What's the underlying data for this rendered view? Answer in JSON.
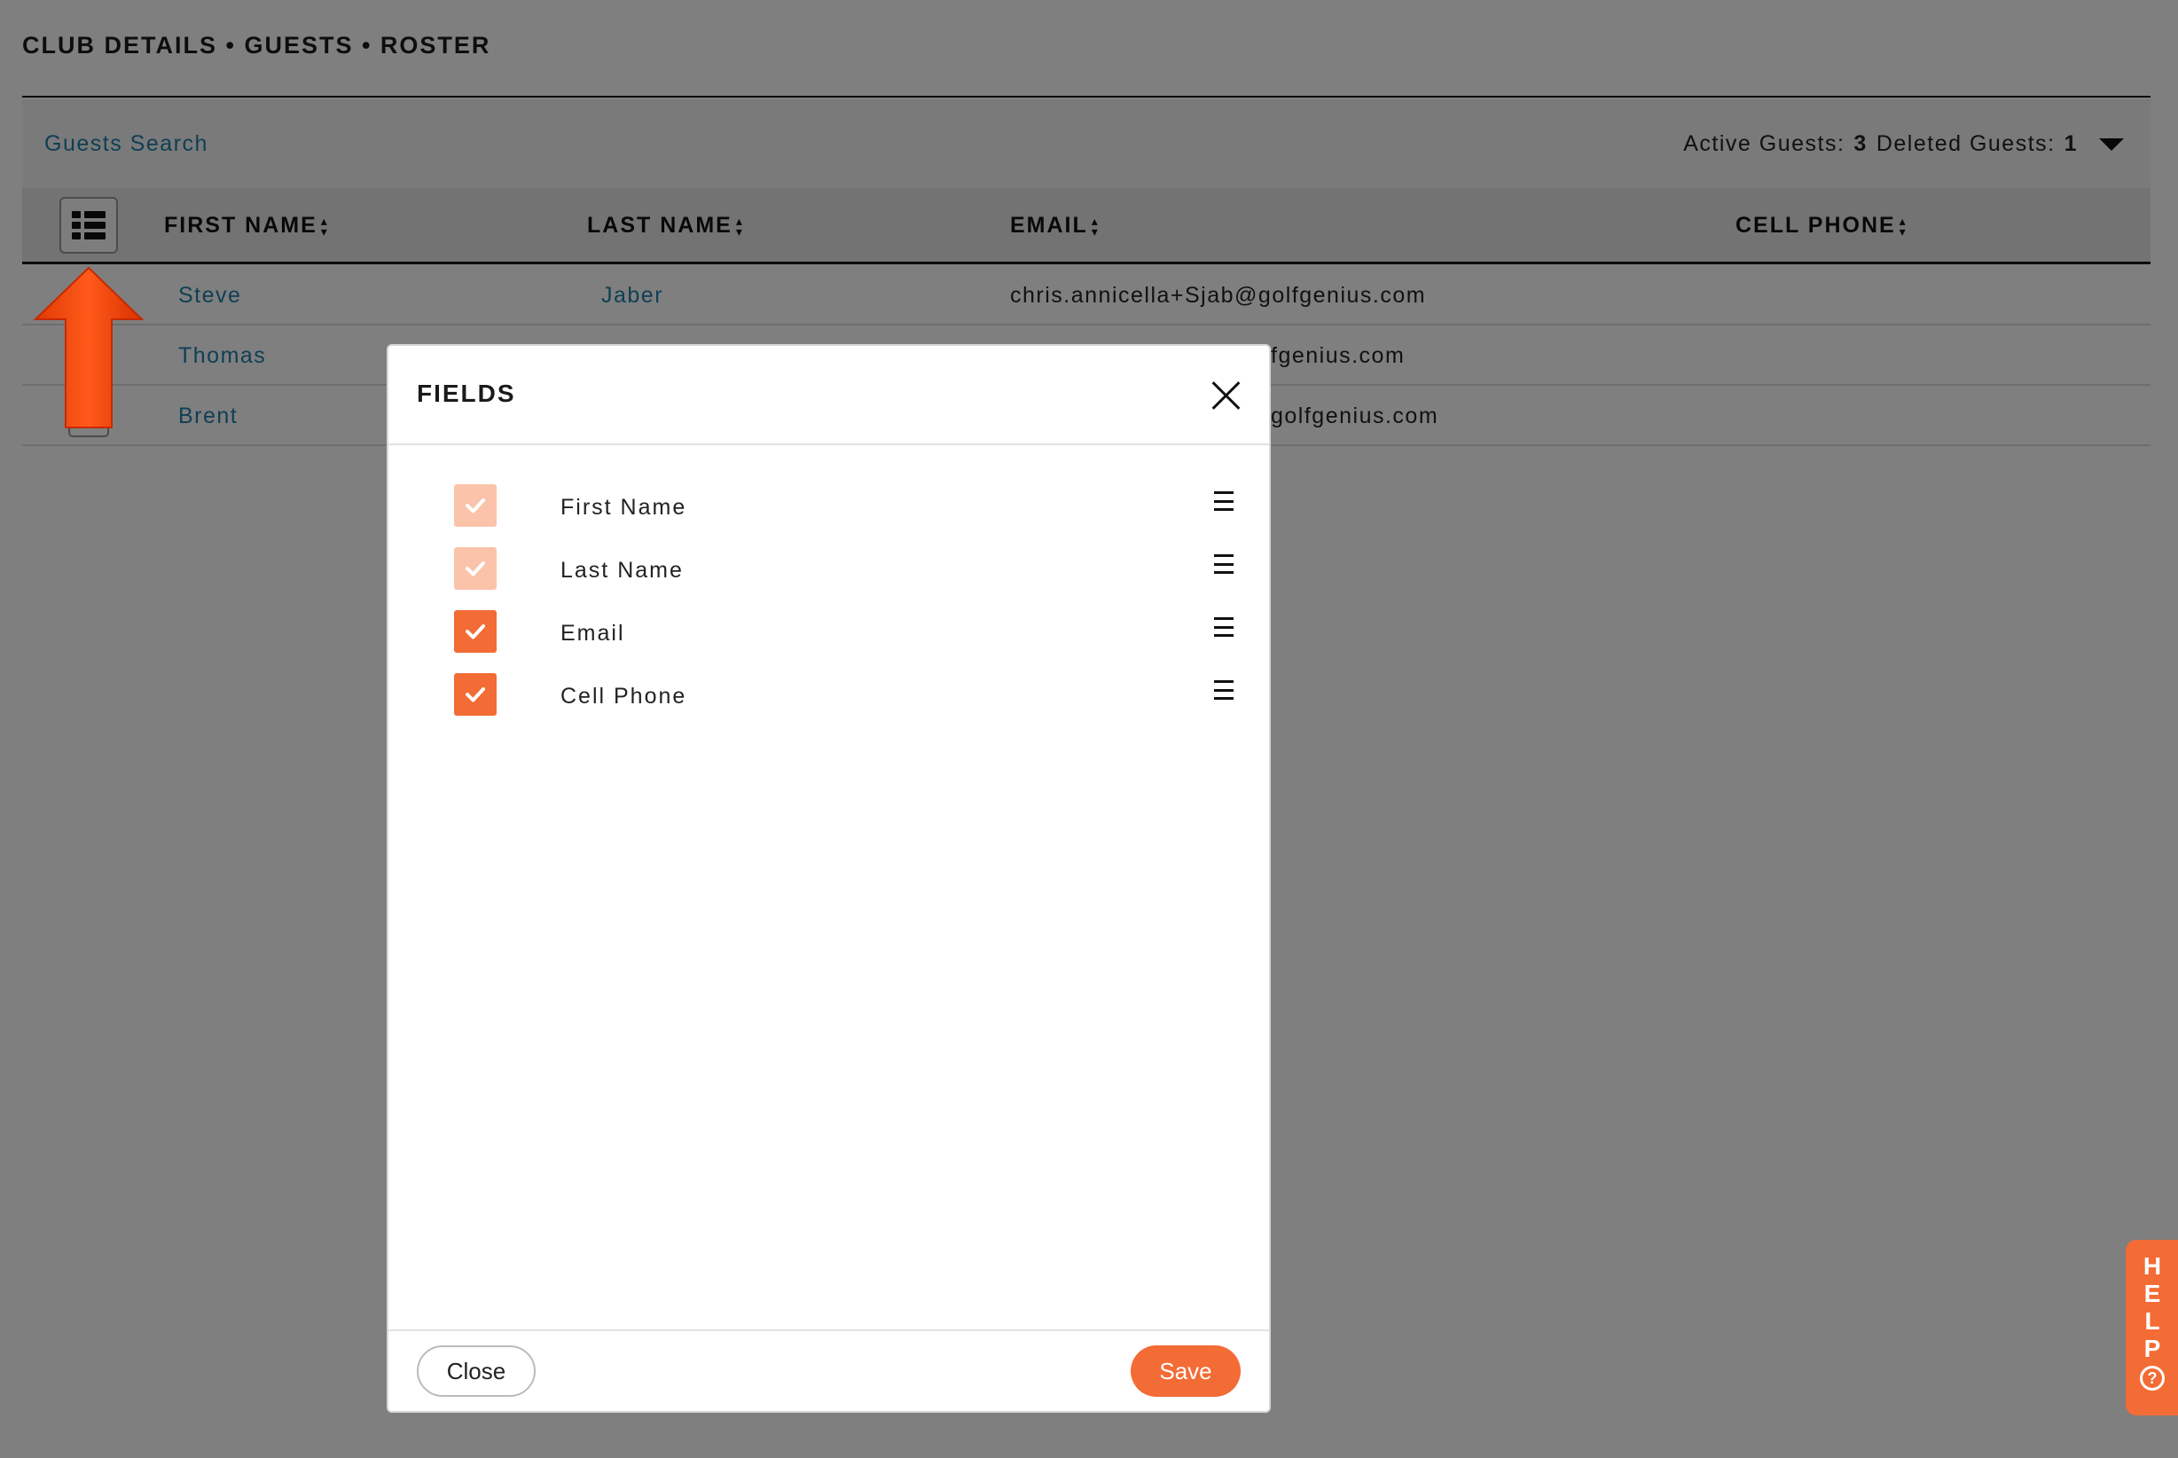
{
  "breadcrumb": "CLUB DETAILS • GUESTS • ROSTER",
  "search": {
    "link_label": "Guests Search",
    "active_label": "Active Guests:",
    "active_count": "3",
    "deleted_label": "Deleted Guests:",
    "deleted_count": "1"
  },
  "table": {
    "columns": [
      "FIRST NAME",
      "LAST NAME",
      "EMAIL",
      "CELL PHONE"
    ],
    "rows": [
      {
        "first": "Steve",
        "last": "Jaber",
        "email": "chris.annicella+Sjab@golfgenius.com",
        "phone": ""
      },
      {
        "first": "Thomas",
        "last": "",
        "email": "fgenius.com",
        "phone": ""
      },
      {
        "first": "Brent",
        "last": "",
        "email": "golfgenius.com",
        "phone": ""
      }
    ]
  },
  "modal": {
    "title": "FIELDS",
    "fields": [
      {
        "label": "First Name",
        "state": "locked"
      },
      {
        "label": "Last Name",
        "state": "locked"
      },
      {
        "label": "Email",
        "state": "checked"
      },
      {
        "label": "Cell Phone",
        "state": "checked"
      }
    ],
    "close_label": "Close",
    "save_label": "Save"
  },
  "help": {
    "letters": [
      "H",
      "E",
      "L",
      "P"
    ],
    "question": "?"
  },
  "colors": {
    "accent": "#f36b35",
    "accent_light": "#fbc3aa",
    "link": "#1f7fa8",
    "annotation_arrow": "#ff4a10"
  },
  "icons": {
    "column_button": "list-icon",
    "dropdown": "caret-down-icon",
    "close": "close-icon",
    "drag": "drag-handle-icon",
    "check": "check-icon",
    "help": "question-circle-icon",
    "annotation": "red-up-arrow"
  }
}
